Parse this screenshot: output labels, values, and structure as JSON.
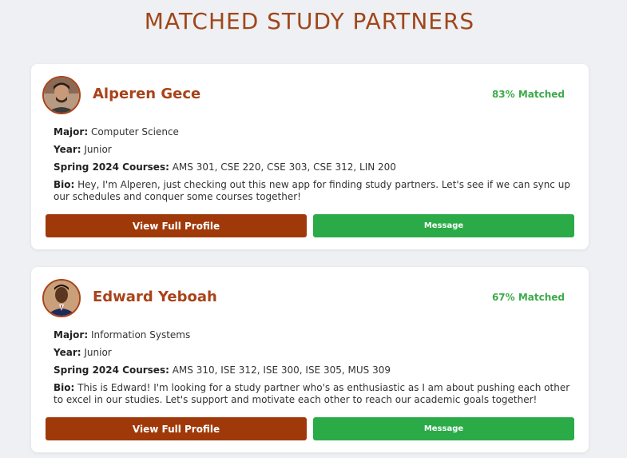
{
  "page": {
    "title": "MATCHED STUDY PARTNERS"
  },
  "labels": {
    "major": "Major:",
    "year": "Year:",
    "courses": "Spring 2024 Courses:",
    "bio": "Bio:"
  },
  "partners": [
    {
      "name": "Alperen Gece",
      "match": "83% Matched",
      "major": "Computer Science",
      "year": "Junior",
      "courses": "AMS 301, CSE 220, CSE 303, CSE 312, LIN 200",
      "bio": "Hey, I'm Alperen, just checking out this new app for finding study partners. Let's see if we can sync up our schedules and conquer some courses together!",
      "view_label": "View Full Profile",
      "message_label": "Message"
    },
    {
      "name": "Edward Yeboah",
      "match": "67% Matched",
      "major": "Information Systems",
      "year": "Junior",
      "courses": "AMS 310, ISE 312, ISE 300, ISE 305, MUS 309",
      "bio": "This is Edward! I'm looking for a study partner who's as enthusiastic as I am about pushing each other to excel in our studies. Let's support and motivate each other to reach our academic goals together!",
      "view_label": "View Full Profile",
      "message_label": "Message"
    }
  ],
  "colors": {
    "accent": "#a9431a",
    "primary_button": "#a0390a",
    "message_button": "#2aab48",
    "match_text": "#3cab4a",
    "background": "#eef0f3"
  }
}
